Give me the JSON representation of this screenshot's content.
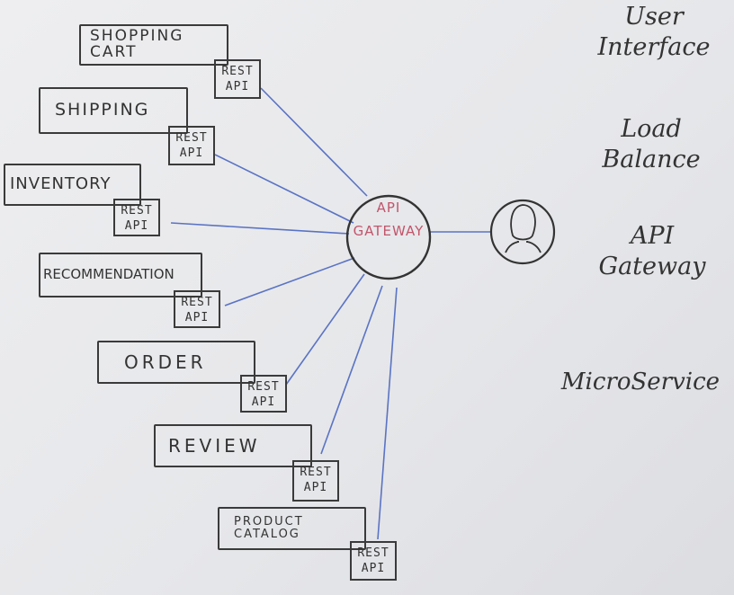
{
  "services": [
    {
      "name": "SHOPPING CART",
      "api": [
        "REST",
        "API"
      ]
    },
    {
      "name": "SHIPPING",
      "api": [
        "REST",
        "API"
      ]
    },
    {
      "name": "INVENTORY",
      "api": [
        "REST",
        "API"
      ]
    },
    {
      "name": "RECOMMENDATION",
      "api": [
        "REST",
        "API"
      ]
    },
    {
      "name": "ORDER",
      "api": [
        "REST",
        "API"
      ]
    },
    {
      "name": "REVIEW",
      "api": [
        "REST",
        "API"
      ]
    },
    {
      "name_lines": [
        "PRODUCT",
        "CATALOG"
      ],
      "api": [
        "REST",
        "API"
      ]
    }
  ],
  "gateway": {
    "lines": [
      "API",
      "GATEWAY"
    ]
  },
  "user": {
    "icon": "user-avatar-icon"
  },
  "layers": {
    "ui": [
      "User",
      "Interface"
    ],
    "lb": [
      "Load",
      "Balance"
    ],
    "gw": [
      "API",
      "Gateway"
    ],
    "ms": [
      "MicroService"
    ]
  },
  "colors": {
    "connector": "#5a73c4",
    "gateway_text": "#c2556b",
    "ink": "#333333"
  }
}
